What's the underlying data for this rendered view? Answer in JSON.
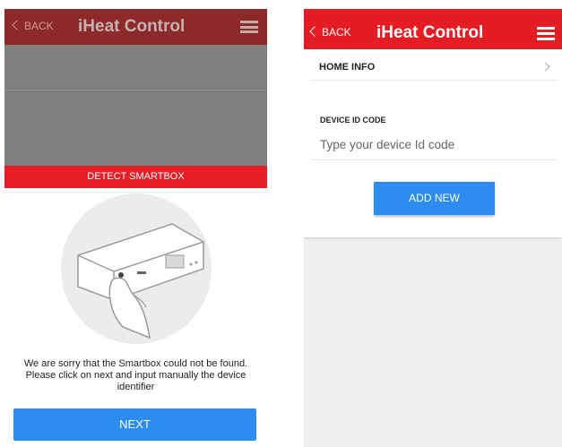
{
  "left": {
    "header": {
      "back_label": "BACK",
      "title": "iHeat Control"
    },
    "detect_bar": "DETECT SMARTBOX",
    "message": "We are sorry that the Smartbox could not be found. Please click on next and input manually the device identifier",
    "next_label": "NEXT"
  },
  "right": {
    "header": {
      "back_label": "BACK",
      "title": "iHeat Control"
    },
    "home_info_label": "HOME INFO",
    "device_id_label": "DEVICE ID CODE",
    "device_id_placeholder": "Type your device Id code",
    "device_id_value": "",
    "add_new_label": "ADD NEW"
  },
  "colors": {
    "brand_red": "#e41c24",
    "button_blue": "#2d8cf0",
    "dimmed_header": "#8e2929"
  },
  "icons": [
    "chevron-left-icon",
    "hamburger-menu-icon",
    "chevron-right-icon"
  ]
}
